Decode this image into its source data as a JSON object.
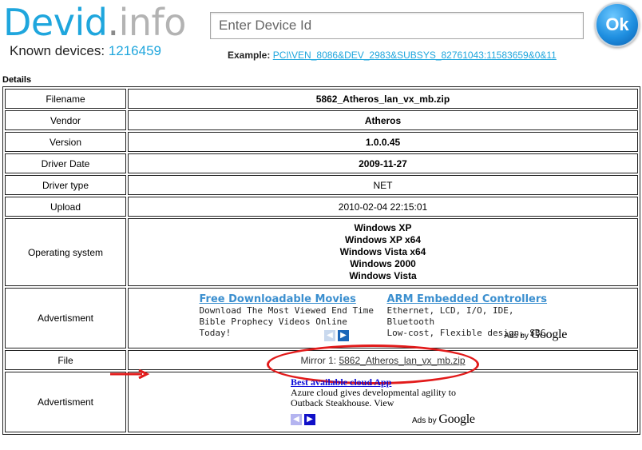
{
  "header": {
    "logo_part1": "Devid",
    "logo_part2": ".",
    "logo_part3": "info",
    "known_label": "Known devices:",
    "known_count": "1216459",
    "search_placeholder": "Enter Device Id",
    "ok_label": "Ok",
    "example_label": "Example:",
    "example_link": "PCI\\VEN_8086&DEV_2983&SUBSYS_82761043:11583659&0&11"
  },
  "details_label": "Details",
  "rows": {
    "filename": {
      "label": "Filename",
      "value": "5862_Atheros_lan_vx_mb.zip"
    },
    "vendor": {
      "label": "Vendor",
      "value": "Atheros"
    },
    "version": {
      "label": "Version",
      "value": "1.0.0.45"
    },
    "driver_date": {
      "label": "Driver Date",
      "value": "2009-11-27"
    },
    "driver_type": {
      "label": "Driver type",
      "value": "NET"
    },
    "upload": {
      "label": "Upload",
      "value": "2010-02-04 22:15:01"
    },
    "os": {
      "label": "Operating system",
      "values": [
        "Windows XP",
        "Windows XP x64",
        "Windows Vista x64",
        "Windows 2000",
        "Windows Vista"
      ]
    },
    "ad1": {
      "label": "Advertisment",
      "items": [
        {
          "title": "Free Downloadable Movies",
          "line1": "Download The Most Viewed End Time",
          "line2": "Bible Prophecy Videos Online Today!"
        },
        {
          "title": "ARM Embedded Controllers",
          "line1": "Ethernet, LCD, I/O, IDE, Bluetooth",
          "line2": "Low-cost, Flexible design, SBC"
        }
      ],
      "ads_by": "Ads by",
      "google": "Google"
    },
    "file": {
      "label": "File",
      "mirror_label": "Mirror 1:",
      "mirror_link": "5862_Atheros_lan_vx_mb.zip"
    },
    "ad2": {
      "label": "Advertisment",
      "title": "Best available cloud App",
      "line1": "Azure cloud gives developmental agility to",
      "line2": "Outback Steakhouse. View",
      "ads_by": "Ads by",
      "google": "Google"
    }
  },
  "colors": {
    "brand_blue": "#1fa6dd",
    "annotation_red": "#e21b1b"
  }
}
